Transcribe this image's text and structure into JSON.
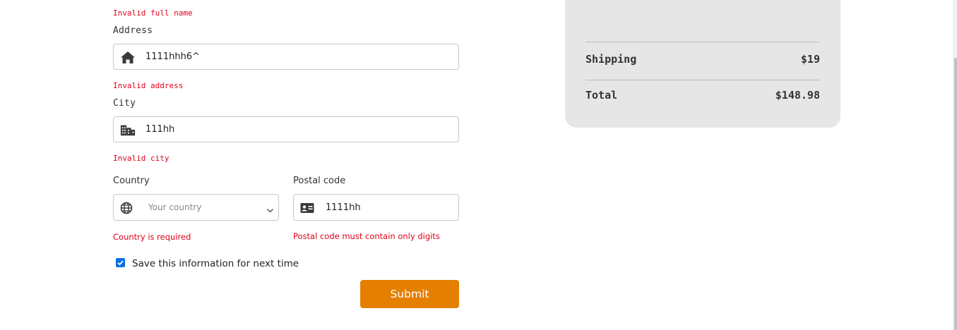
{
  "form": {
    "full_name_error": "Invalid full name",
    "address": {
      "label": "Address",
      "value": "1111hhh6^",
      "error": "Invalid address",
      "icon": "home-icon"
    },
    "city": {
      "label": "City",
      "value": "111hh",
      "error": "Invalid city",
      "icon": "city-icon"
    },
    "country": {
      "label": "Country",
      "placeholder": "Your country",
      "error": "Country is required",
      "icon": "globe-icon"
    },
    "postal_code": {
      "label": "Postal code",
      "value": "1111hh",
      "error": "Postal code must contain only digits",
      "icon": "id-card-icon"
    },
    "save_info": {
      "label": "Save this information for next time",
      "checked": true
    },
    "submit_label": "Submit"
  },
  "summary": {
    "shipping_label": "Shipping",
    "shipping_value": "$19",
    "total_label": "Total",
    "total_value": "$148.98"
  },
  "colors": {
    "error": "#e0001a",
    "accent": "#e57f00",
    "checkbox": "#0a6ee6",
    "summary_bg": "#e6e6e6"
  }
}
